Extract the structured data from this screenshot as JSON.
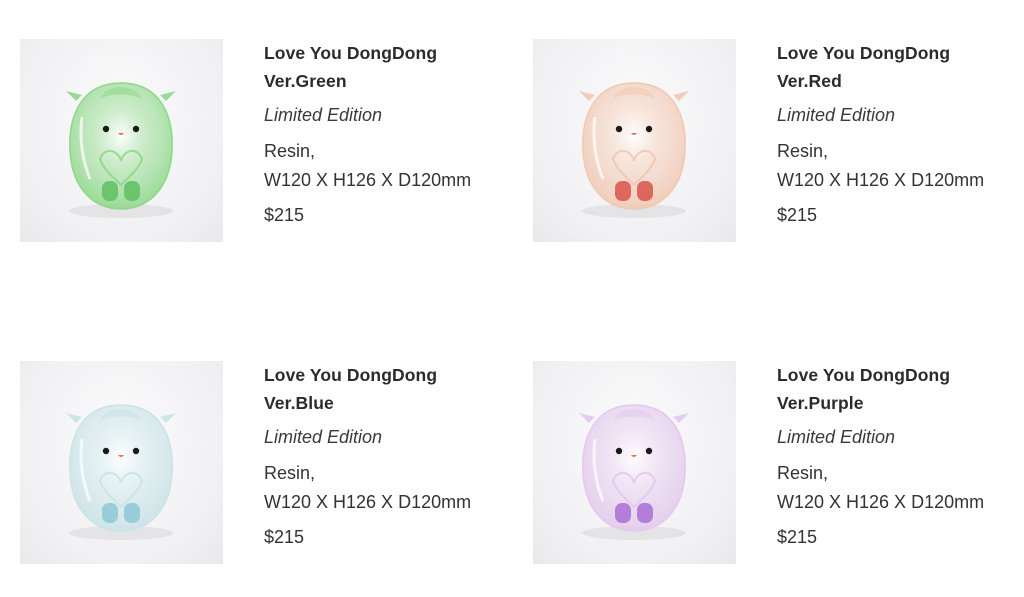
{
  "products": [
    {
      "name_line1": "Love You DongDong",
      "name_line2": "Ver.Green",
      "edition": "Limited Edition",
      "material": "Resin,",
      "dimensions": "W120 X H126 X D120mm",
      "price": "$215",
      "color": "#8fd88a",
      "accent": "#5fbf62"
    },
    {
      "name_line1": "Love You DongDong",
      "name_line2": "Ver.Red",
      "edition": "Limited Edition",
      "material": "Resin,",
      "dimensions": "W120 X H126 X D120mm",
      "price": "$215",
      "color": "#f1c8b2",
      "accent": "#d9534a"
    },
    {
      "name_line1": "Love You DongDong",
      "name_line2": "Ver.Blue",
      "edition": "Limited Edition",
      "material": "Resin,",
      "dimensions": "W120 X H126 X D120mm",
      "price": "$215",
      "color": "#c9e3e6",
      "accent": "#8ec7d6"
    },
    {
      "name_line1": "Love You DongDong",
      "name_line2": "Ver.Purple",
      "edition": "Limited Edition",
      "material": "Resin,",
      "dimensions": "W120 X H126 X D120mm",
      "price": "$215",
      "color": "#e3c9ec",
      "accent": "#a86fd6"
    }
  ]
}
